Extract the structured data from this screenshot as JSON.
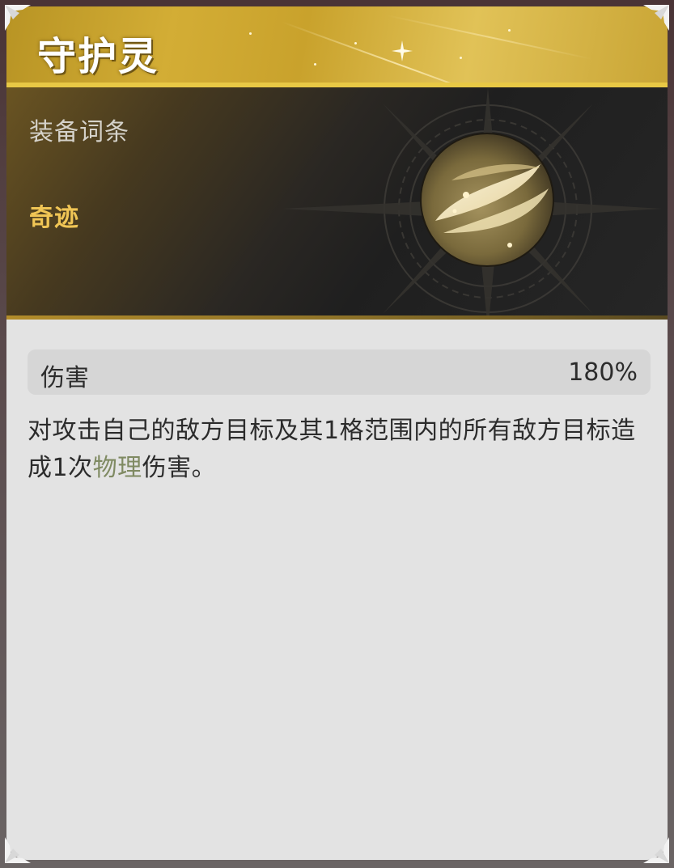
{
  "item": {
    "name": "守护灵",
    "section_label": "装备词条",
    "rarity": "奇迹"
  },
  "stats": [
    {
      "name": "伤害",
      "value": "180%"
    }
  ],
  "description": {
    "before": "对攻击自己的敌方目标及其1格范围内的所有敌方目标造成1次",
    "highlight": "物理",
    "after": "伤害。"
  },
  "colors": {
    "gold": "#d3ad35",
    "rarity": "#f0c555",
    "highlight": "#7f8a62",
    "panel": "#e3e3e3"
  },
  "icons": {
    "emblem": "gold-swirl-orb-icon",
    "background": "compass-star-icon",
    "corners": "corner-ornament-icon"
  }
}
